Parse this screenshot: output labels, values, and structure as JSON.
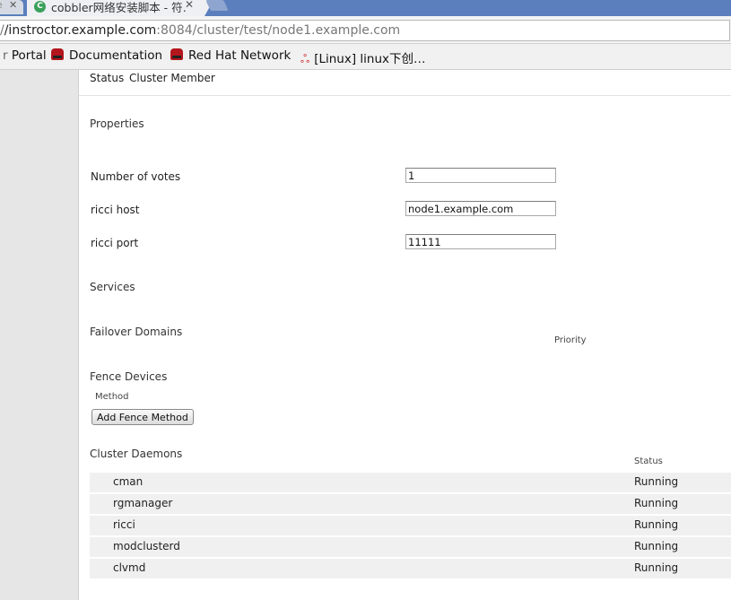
{
  "browser": {
    "prev_tab_fragment": "e",
    "active_tab_title": "cobbler网络安装脚本 - 符…",
    "url_scheme": "/",
    "url_host": "/instroctor.example.com",
    "url_rest": ":8084/cluster/test/node1.example.com",
    "bookmarks": [
      "Portal",
      "Documentation",
      "Red Hat Network",
      "[Linux] linux下创…"
    ]
  },
  "node": {
    "status_label": "Status",
    "status_value": "Cluster Member",
    "properties_heading": "Properties",
    "fields": [
      {
        "label": "Number of votes",
        "value": "1"
      },
      {
        "label": "ricci host",
        "value": "node1.example.com"
      },
      {
        "label": "ricci port",
        "value": "11111"
      }
    ],
    "services_heading": "Services",
    "failover_heading": "Failover Domains",
    "priority_col": "Priority",
    "fence_heading": "Fence Devices",
    "method_col": "Method",
    "add_fence_label": "Add Fence Method",
    "daemons_heading": "Cluster Daemons",
    "daemons_status_col": "Status",
    "daemons": [
      {
        "name": "cman",
        "status": "Running"
      },
      {
        "name": "rgmanager",
        "status": "Running"
      },
      {
        "name": "ricci",
        "status": "Running"
      },
      {
        "name": "modclusterd",
        "status": "Running"
      },
      {
        "name": "clvmd",
        "status": "Running"
      }
    ]
  },
  "colors": {
    "tabbar": "#5b7fbd",
    "redhat": "#b3161c",
    "row_bg": "#f0f0f0"
  }
}
